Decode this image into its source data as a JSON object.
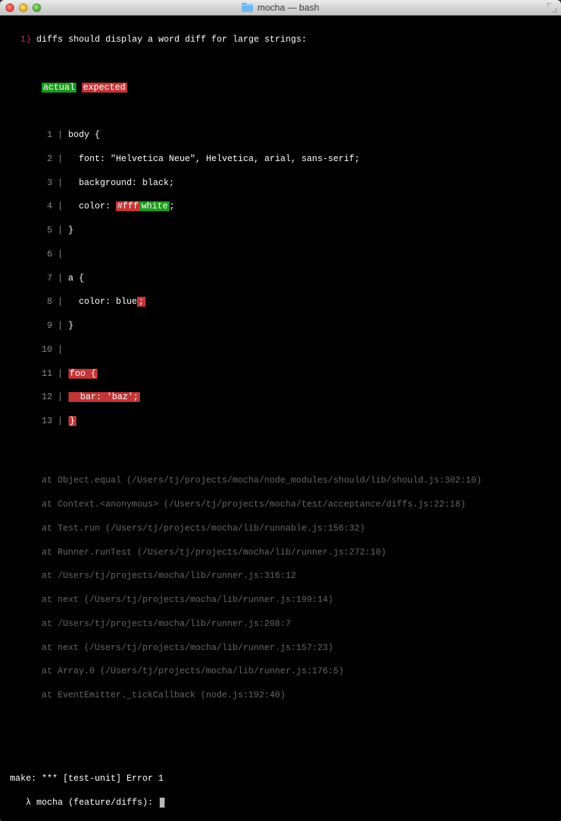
{
  "window": {
    "title": "mocha — bash"
  },
  "test": {
    "number": "1)",
    "title": "diffs should display a word diff for large strings:"
  },
  "legend": {
    "actual": "actual",
    "expected": "expected"
  },
  "diff": {
    "lines": [
      {
        "n": "1",
        "segments": [
          {
            "t": " body {",
            "c": "white"
          }
        ]
      },
      {
        "n": "2",
        "segments": [
          {
            "t": "   font: \"Helvetica Neue\", Helvetica, arial, sans-serif;",
            "c": "white"
          }
        ]
      },
      {
        "n": "3",
        "segments": [
          {
            "t": "   background: black;",
            "c": "white"
          }
        ]
      },
      {
        "n": "4",
        "segments": [
          {
            "t": "   color: ",
            "c": "white"
          },
          {
            "t": "#fff",
            "c": "hl-red"
          },
          {
            "t": "white",
            "c": "hl-green"
          },
          {
            "t": ";",
            "c": "white"
          }
        ]
      },
      {
        "n": "5",
        "segments": [
          {
            "t": " }",
            "c": "white"
          }
        ]
      },
      {
        "n": "6",
        "segments": [
          {
            "t": " ",
            "c": "white"
          }
        ]
      },
      {
        "n": "7",
        "segments": [
          {
            "t": " a {",
            "c": "white"
          }
        ]
      },
      {
        "n": "8",
        "segments": [
          {
            "t": "   color: blue",
            "c": "white"
          },
          {
            "t": ";",
            "c": "hl-red"
          }
        ]
      },
      {
        "n": "9",
        "segments": [
          {
            "t": " }",
            "c": "white"
          }
        ]
      },
      {
        "n": "10",
        "segments": [
          {
            "t": " ",
            "c": "white"
          }
        ]
      },
      {
        "n": "11",
        "segments": [
          {
            "t": " ",
            "c": "white"
          },
          {
            "t": "foo {",
            "c": "hl-red"
          }
        ]
      },
      {
        "n": "12",
        "segments": [
          {
            "t": " ",
            "c": "white"
          },
          {
            "t": "  bar: 'baz';",
            "c": "hl-red"
          }
        ]
      },
      {
        "n": "13",
        "segments": [
          {
            "t": " ",
            "c": "white"
          },
          {
            "t": "}",
            "c": "hl-red"
          }
        ]
      }
    ]
  },
  "stack": [
    "at Object.equal (/Users/tj/projects/mocha/node_modules/should/lib/should.js:302:10)",
    "at Context.<anonymous> (/Users/tj/projects/mocha/test/acceptance/diffs.js:22:18)",
    "at Test.run (/Users/tj/projects/mocha/lib/runnable.js:156:32)",
    "at Runner.runTest (/Users/tj/projects/mocha/lib/runner.js:272:10)",
    "at /Users/tj/projects/mocha/lib/runner.js:316:12",
    "at next (/Users/tj/projects/mocha/lib/runner.js:199:14)",
    "at /Users/tj/projects/mocha/lib/runner.js:208:7",
    "at next (/Users/tj/projects/mocha/lib/runner.js:157:23)",
    "at Array.0 (/Users/tj/projects/mocha/lib/runner.js:176:5)",
    "at EventEmitter._tickCallback (node.js:192:40)"
  ],
  "make_error": "make: *** [test-unit] Error 1",
  "prompt": {
    "symbol": "λ",
    "path": "mocha",
    "branch_open": "(",
    "branch": "feature/diffs",
    "branch_close": "):"
  }
}
